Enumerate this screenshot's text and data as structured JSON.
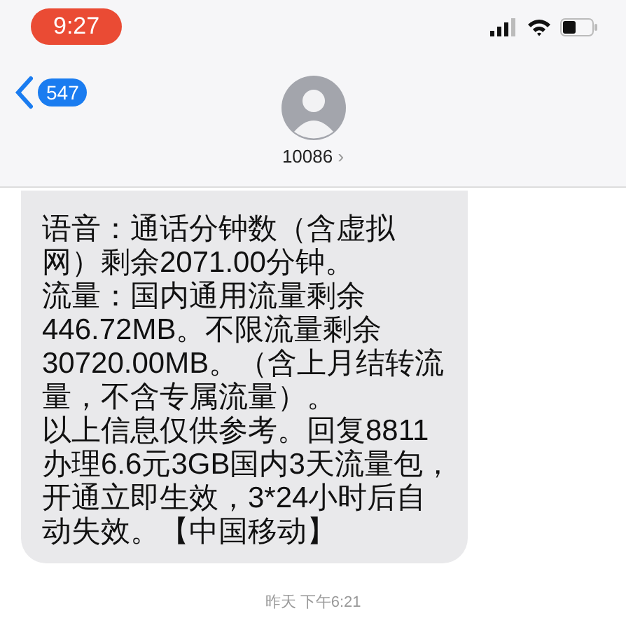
{
  "status_bar": {
    "time": "9:27"
  },
  "header": {
    "back_count": "547",
    "contact": "10086",
    "chevron": "›"
  },
  "message": {
    "lines": [
      "语音：通话分钟数（含虚拟",
      "网）剩余2071.00分钟。",
      "流量：国内通用流量剩余",
      "446.72MB。不限流量剩余",
      "30720.00MB。（含上月结转流",
      "量，不含专属流量）。",
      "以上信息仅供参考。回复8811",
      "办理6.6元3GB国内3天流量包，",
      "开通立即生效，3*24小时后自",
      "动失效。【中国移动】"
    ]
  },
  "timestamp": "昨天 下午6:21"
}
